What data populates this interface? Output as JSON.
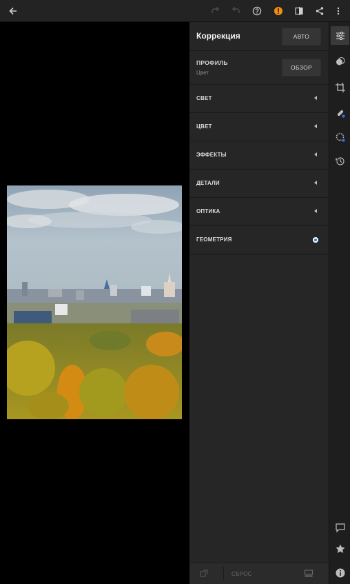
{
  "topbar": {
    "icons": [
      "back-arrow-icon",
      "redo-icon",
      "undo-icon",
      "help-icon",
      "warning-icon",
      "compare-icon",
      "share-icon",
      "more-icon"
    ]
  },
  "colors": {
    "panel_bg": "#262626",
    "accent_blue": "#2b78e4",
    "warning_orange": "#f0900f"
  },
  "panel": {
    "title": "Коррекция",
    "auto_label": "АВТО",
    "profile": {
      "label": "ПРОФИЛЬ",
      "value": "Цвет",
      "browse_label": "ОБЗОР"
    },
    "sections": [
      {
        "label": "СВЕТ",
        "indicator": "chevron-left"
      },
      {
        "label": "ЦВЕТ",
        "indicator": "chevron-left"
      },
      {
        "label": "ЭФФЕКТЫ",
        "indicator": "chevron-left"
      },
      {
        "label": "ДЕТАЛИ",
        "indicator": "chevron-left"
      },
      {
        "label": "ОПТИКА",
        "indicator": "chevron-left"
      },
      {
        "label": "ГЕОМЕТРИЯ",
        "indicator": "blue-dot"
      }
    ],
    "footer": {
      "reset_label": "СБРОС"
    }
  },
  "rail": {
    "icons": [
      "edit-sliders-icon",
      "presets-icon",
      "crop-icon",
      "healing-brush-icon",
      "selective-icon",
      "history-icon",
      "comment-icon",
      "star-icon",
      "info-icon"
    ],
    "active": "edit-sliders-icon"
  }
}
